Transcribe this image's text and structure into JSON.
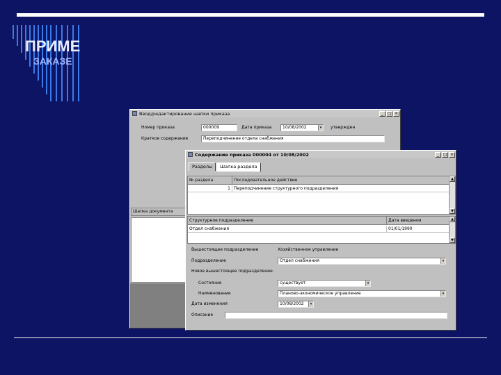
{
  "slide": {
    "title": "ПРИМЕ",
    "subtitle": "ЗАКАЗЕ"
  },
  "back_window": {
    "title": "Ввод/редактирование шапки приказа",
    "order_number_label": "Номер приказа",
    "order_number_value": "000009",
    "order_date_label": "Дата приказа",
    "order_date_value": "10/08/2002",
    "status_value": "утвержден",
    "summary_label": "Краткое содержание",
    "summary_value": "Переподчинение отдела снабжения",
    "list_header": "Шапка документа"
  },
  "front_window": {
    "title": "Содержание приказа 000004 от 10/08/2002",
    "tabs": [
      "Разделы",
      "Шапка раздела"
    ],
    "grid1": {
      "headers": [
        "№ раздела",
        "Последовательное действие"
      ],
      "rows": [
        [
          "1",
          "Переподчинение структурного подразделения"
        ]
      ]
    },
    "grid2": {
      "headers": [
        "Структурное подразделение",
        "Дата введения"
      ],
      "rows": [
        [
          "Отдел снабжения",
          "01/01/1990"
        ]
      ]
    },
    "form": {
      "parent_label": "Вышестоящее подразделение",
      "parent_value": "Хозяйственное управление",
      "subdivision_label": "Подразделение",
      "subdivision_value": "Отдел снабжения",
      "new_parent_label": "Новое вышестоящее подразделение",
      "state_label": "Состояние",
      "state_value": "существует",
      "name_label": "Наименование",
      "name_value": "Планово-экономическое управление",
      "change_date_label": "Дата изменения",
      "change_date_value": "10/08/2002",
      "comment_label": "Описание"
    }
  }
}
